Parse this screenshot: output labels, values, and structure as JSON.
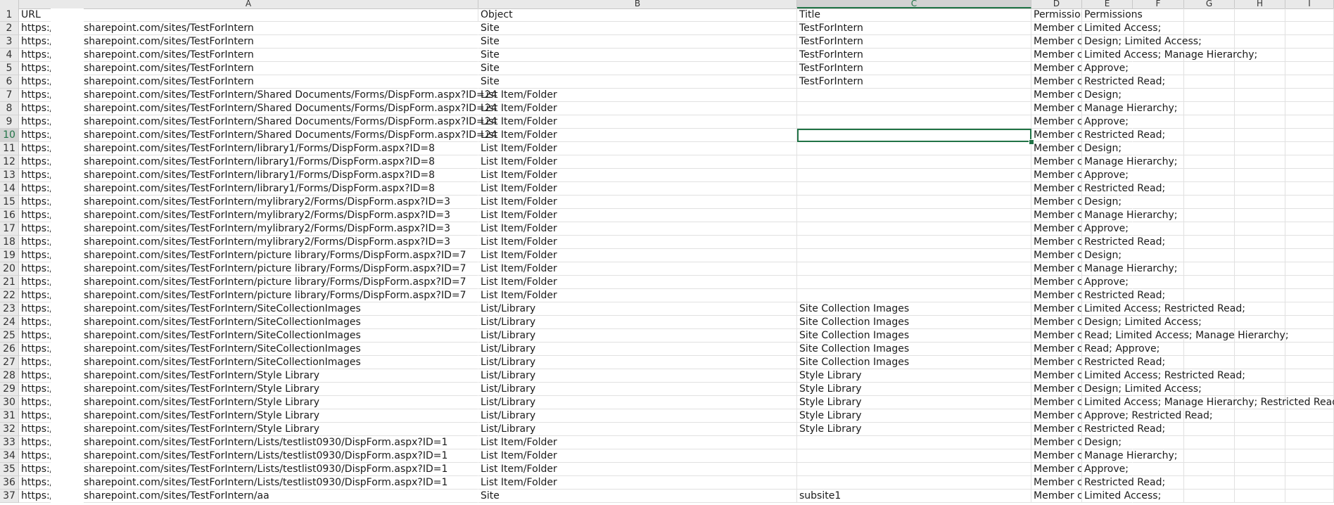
{
  "columns": [
    "A",
    "B",
    "C",
    "D",
    "E",
    "F",
    "G",
    "H",
    "I"
  ],
  "selected_column": "C",
  "selected_row": "10",
  "header": {
    "row": "1",
    "url": "URL",
    "object": "Object",
    "title": "Title",
    "permission": "Permissior",
    "permissions": "Permissions"
  },
  "rows": [
    {
      "n": "2",
      "prefix": "https:/",
      "url": "sharepoint.com/sites/TestForIntern",
      "object": "Site",
      "title": "TestForIntern",
      "member": "Member c",
      "perm": "Limited Access;"
    },
    {
      "n": "3",
      "prefix": "https:/",
      "url": "sharepoint.com/sites/TestForIntern",
      "object": "Site",
      "title": "TestForIntern",
      "member": "Member c",
      "perm": "Design; Limited Access;"
    },
    {
      "n": "4",
      "prefix": "https:/",
      "url": "sharepoint.com/sites/TestForIntern",
      "object": "Site",
      "title": "TestForIntern",
      "member": "Member c",
      "perm": "Limited Access; Manage Hierarchy;"
    },
    {
      "n": "5",
      "prefix": "https:/",
      "url": "sharepoint.com/sites/TestForIntern",
      "object": "Site",
      "title": "TestForIntern",
      "member": "Member c",
      "perm": "Approve;"
    },
    {
      "n": "6",
      "prefix": "https:/",
      "url": "sharepoint.com/sites/TestForIntern",
      "object": "Site",
      "title": "TestForIntern",
      "member": "Member c",
      "perm": "Restricted Read;"
    },
    {
      "n": "7",
      "prefix": "https:/",
      "url": "sharepoint.com/sites/TestForIntern/Shared Documents/Forms/DispForm.aspx?ID=24",
      "object": "List Item/Folder",
      "title": "",
      "member": "Member c",
      "perm": "Design;"
    },
    {
      "n": "8",
      "prefix": "https:/",
      "url": "sharepoint.com/sites/TestForIntern/Shared Documents/Forms/DispForm.aspx?ID=24",
      "object": "List Item/Folder",
      "title": "",
      "member": "Member c",
      "perm": "Manage Hierarchy;"
    },
    {
      "n": "9",
      "prefix": "https:/",
      "url": "sharepoint.com/sites/TestForIntern/Shared Documents/Forms/DispForm.aspx?ID=24",
      "object": "List Item/Folder",
      "title": "",
      "member": "Member c",
      "perm": "Approve;"
    },
    {
      "n": "10",
      "prefix": "https:/",
      "url": "sharepoint.com/sites/TestForIntern/Shared Documents/Forms/DispForm.aspx?ID=24",
      "object": "List Item/Folder",
      "title": "",
      "member": "Member c",
      "perm": "Restricted Read;"
    },
    {
      "n": "11",
      "prefix": "https:/",
      "url": "sharepoint.com/sites/TestForIntern/library1/Forms/DispForm.aspx?ID=8",
      "object": "List Item/Folder",
      "title": "",
      "member": "Member c",
      "perm": "Design;"
    },
    {
      "n": "12",
      "prefix": "https:/",
      "url": "sharepoint.com/sites/TestForIntern/library1/Forms/DispForm.aspx?ID=8",
      "object": "List Item/Folder",
      "title": "",
      "member": "Member c",
      "perm": "Manage Hierarchy;"
    },
    {
      "n": "13",
      "prefix": "https:/",
      "url": "sharepoint.com/sites/TestForIntern/library1/Forms/DispForm.aspx?ID=8",
      "object": "List Item/Folder",
      "title": "",
      "member": "Member c",
      "perm": "Approve;"
    },
    {
      "n": "14",
      "prefix": "https:/",
      "url": "sharepoint.com/sites/TestForIntern/library1/Forms/DispForm.aspx?ID=8",
      "object": "List Item/Folder",
      "title": "",
      "member": "Member c",
      "perm": "Restricted Read;"
    },
    {
      "n": "15",
      "prefix": "https:/",
      "url": "sharepoint.com/sites/TestForIntern/mylibrary2/Forms/DispForm.aspx?ID=3",
      "object": "List Item/Folder",
      "title": "",
      "member": "Member c",
      "perm": "Design;"
    },
    {
      "n": "16",
      "prefix": "https:/",
      "url": "sharepoint.com/sites/TestForIntern/mylibrary2/Forms/DispForm.aspx?ID=3",
      "object": "List Item/Folder",
      "title": "",
      "member": "Member c",
      "perm": "Manage Hierarchy;"
    },
    {
      "n": "17",
      "prefix": "https:/",
      "url": "sharepoint.com/sites/TestForIntern/mylibrary2/Forms/DispForm.aspx?ID=3",
      "object": "List Item/Folder",
      "title": "",
      "member": "Member c",
      "perm": "Approve;"
    },
    {
      "n": "18",
      "prefix": "https:/",
      "url": "sharepoint.com/sites/TestForIntern/mylibrary2/Forms/DispForm.aspx?ID=3",
      "object": "List Item/Folder",
      "title": "",
      "member": "Member c",
      "perm": "Restricted Read;"
    },
    {
      "n": "19",
      "prefix": "https:/",
      "url": "sharepoint.com/sites/TestForIntern/picture library/Forms/DispForm.aspx?ID=7",
      "object": "List Item/Folder",
      "title": "",
      "member": "Member c",
      "perm": "Design;"
    },
    {
      "n": "20",
      "prefix": "https:/",
      "url": "sharepoint.com/sites/TestForIntern/picture library/Forms/DispForm.aspx?ID=7",
      "object": "List Item/Folder",
      "title": "",
      "member": "Member c",
      "perm": "Manage Hierarchy;"
    },
    {
      "n": "21",
      "prefix": "https:/",
      "url": "sharepoint.com/sites/TestForIntern/picture library/Forms/DispForm.aspx?ID=7",
      "object": "List Item/Folder",
      "title": "",
      "member": "Member c",
      "perm": "Approve;"
    },
    {
      "n": "22",
      "prefix": "https:/",
      "url": "sharepoint.com/sites/TestForIntern/picture library/Forms/DispForm.aspx?ID=7",
      "object": "List Item/Folder",
      "title": "",
      "member": "Member c",
      "perm": "Restricted Read;"
    },
    {
      "n": "23",
      "prefix": "https:/",
      "url": "sharepoint.com/sites/TestForIntern/SiteCollectionImages",
      "object": "List/Library",
      "title": "Site Collection Images",
      "member": "Member c",
      "perm": "Limited Access; Restricted Read;"
    },
    {
      "n": "24",
      "prefix": "https:/",
      "url": "sharepoint.com/sites/TestForIntern/SiteCollectionImages",
      "object": "List/Library",
      "title": "Site Collection Images",
      "member": "Member c",
      "perm": "Design; Limited Access;"
    },
    {
      "n": "25",
      "prefix": "https:/",
      "url": "sharepoint.com/sites/TestForIntern/SiteCollectionImages",
      "object": "List/Library",
      "title": "Site Collection Images",
      "member": "Member c",
      "perm": "Read; Limited Access; Manage Hierarchy;"
    },
    {
      "n": "26",
      "prefix": "https:/",
      "url": "sharepoint.com/sites/TestForIntern/SiteCollectionImages",
      "object": "List/Library",
      "title": "Site Collection Images",
      "member": "Member c",
      "perm": "Read; Approve;"
    },
    {
      "n": "27",
      "prefix": "https:/",
      "url": "sharepoint.com/sites/TestForIntern/SiteCollectionImages",
      "object": "List/Library",
      "title": "Site Collection Images",
      "member": "Member c",
      "perm": "Restricted Read;"
    },
    {
      "n": "28",
      "prefix": "https:/",
      "url": "sharepoint.com/sites/TestForIntern/Style Library",
      "object": "List/Library",
      "title": "Style Library",
      "member": "Member c",
      "perm": "Limited Access; Restricted Read;"
    },
    {
      "n": "29",
      "prefix": "https:/",
      "url": "sharepoint.com/sites/TestForIntern/Style Library",
      "object": "List/Library",
      "title": "Style Library",
      "member": "Member c",
      "perm": "Design; Limited Access;"
    },
    {
      "n": "30",
      "prefix": "https:/",
      "url": "sharepoint.com/sites/TestForIntern/Style Library",
      "object": "List/Library",
      "title": "Style Library",
      "member": "Member c",
      "perm": "Limited Access; Manage Hierarchy; Restricted Read;"
    },
    {
      "n": "31",
      "prefix": "https:/",
      "url": "sharepoint.com/sites/TestForIntern/Style Library",
      "object": "List/Library",
      "title": "Style Library",
      "member": "Member c",
      "perm": "Approve; Restricted Read;"
    },
    {
      "n": "32",
      "prefix": "https:/",
      "url": "sharepoint.com/sites/TestForIntern/Style Library",
      "object": "List/Library",
      "title": "Style Library",
      "member": "Member c",
      "perm": "Restricted Read;"
    },
    {
      "n": "33",
      "prefix": "https:/",
      "url": "sharepoint.com/sites/TestForIntern/Lists/testlist0930/DispForm.aspx?ID=1",
      "object": "List Item/Folder",
      "title": "",
      "member": "Member c",
      "perm": "Design;"
    },
    {
      "n": "34",
      "prefix": "https:/",
      "url": "sharepoint.com/sites/TestForIntern/Lists/testlist0930/DispForm.aspx?ID=1",
      "object": "List Item/Folder",
      "title": "",
      "member": "Member c",
      "perm": "Manage Hierarchy;"
    },
    {
      "n": "35",
      "prefix": "https:/",
      "url": "sharepoint.com/sites/TestForIntern/Lists/testlist0930/DispForm.aspx?ID=1",
      "object": "List Item/Folder",
      "title": "",
      "member": "Member c",
      "perm": "Approve;"
    },
    {
      "n": "36",
      "prefix": "https:/",
      "url": "sharepoint.com/sites/TestForIntern/Lists/testlist0930/DispForm.aspx?ID=1",
      "object": "List Item/Folder",
      "title": "",
      "member": "Member c",
      "perm": "Restricted Read;"
    },
    {
      "n": "37",
      "prefix": "https:/",
      "url": "sharepoint.com/sites/TestForIntern/aa",
      "object": "Site",
      "title": "subsite1",
      "member": "Member c",
      "perm": "Limited Access;"
    }
  ]
}
